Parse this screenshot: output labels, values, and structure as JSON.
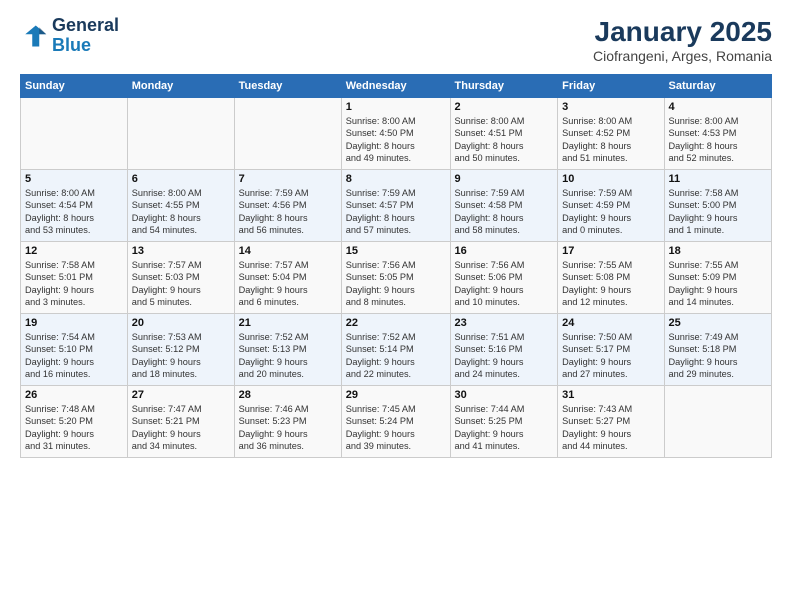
{
  "logo": {
    "line1": "General",
    "line2": "Blue"
  },
  "calendar": {
    "title": "January 2025",
    "subtitle": "Ciofrangeni, Arges, Romania"
  },
  "weekdays": [
    "Sunday",
    "Monday",
    "Tuesday",
    "Wednesday",
    "Thursday",
    "Friday",
    "Saturday"
  ],
  "weeks": [
    [
      {
        "day": "",
        "info": ""
      },
      {
        "day": "",
        "info": ""
      },
      {
        "day": "",
        "info": ""
      },
      {
        "day": "1",
        "info": "Sunrise: 8:00 AM\nSunset: 4:50 PM\nDaylight: 8 hours\nand 49 minutes."
      },
      {
        "day": "2",
        "info": "Sunrise: 8:00 AM\nSunset: 4:51 PM\nDaylight: 8 hours\nand 50 minutes."
      },
      {
        "day": "3",
        "info": "Sunrise: 8:00 AM\nSunset: 4:52 PM\nDaylight: 8 hours\nand 51 minutes."
      },
      {
        "day": "4",
        "info": "Sunrise: 8:00 AM\nSunset: 4:53 PM\nDaylight: 8 hours\nand 52 minutes."
      }
    ],
    [
      {
        "day": "5",
        "info": "Sunrise: 8:00 AM\nSunset: 4:54 PM\nDaylight: 8 hours\nand 53 minutes."
      },
      {
        "day": "6",
        "info": "Sunrise: 8:00 AM\nSunset: 4:55 PM\nDaylight: 8 hours\nand 54 minutes."
      },
      {
        "day": "7",
        "info": "Sunrise: 7:59 AM\nSunset: 4:56 PM\nDaylight: 8 hours\nand 56 minutes."
      },
      {
        "day": "8",
        "info": "Sunrise: 7:59 AM\nSunset: 4:57 PM\nDaylight: 8 hours\nand 57 minutes."
      },
      {
        "day": "9",
        "info": "Sunrise: 7:59 AM\nSunset: 4:58 PM\nDaylight: 8 hours\nand 58 minutes."
      },
      {
        "day": "10",
        "info": "Sunrise: 7:59 AM\nSunset: 4:59 PM\nDaylight: 9 hours\nand 0 minutes."
      },
      {
        "day": "11",
        "info": "Sunrise: 7:58 AM\nSunset: 5:00 PM\nDaylight: 9 hours\nand 1 minute."
      }
    ],
    [
      {
        "day": "12",
        "info": "Sunrise: 7:58 AM\nSunset: 5:01 PM\nDaylight: 9 hours\nand 3 minutes."
      },
      {
        "day": "13",
        "info": "Sunrise: 7:57 AM\nSunset: 5:03 PM\nDaylight: 9 hours\nand 5 minutes."
      },
      {
        "day": "14",
        "info": "Sunrise: 7:57 AM\nSunset: 5:04 PM\nDaylight: 9 hours\nand 6 minutes."
      },
      {
        "day": "15",
        "info": "Sunrise: 7:56 AM\nSunset: 5:05 PM\nDaylight: 9 hours\nand 8 minutes."
      },
      {
        "day": "16",
        "info": "Sunrise: 7:56 AM\nSunset: 5:06 PM\nDaylight: 9 hours\nand 10 minutes."
      },
      {
        "day": "17",
        "info": "Sunrise: 7:55 AM\nSunset: 5:08 PM\nDaylight: 9 hours\nand 12 minutes."
      },
      {
        "day": "18",
        "info": "Sunrise: 7:55 AM\nSunset: 5:09 PM\nDaylight: 9 hours\nand 14 minutes."
      }
    ],
    [
      {
        "day": "19",
        "info": "Sunrise: 7:54 AM\nSunset: 5:10 PM\nDaylight: 9 hours\nand 16 minutes."
      },
      {
        "day": "20",
        "info": "Sunrise: 7:53 AM\nSunset: 5:12 PM\nDaylight: 9 hours\nand 18 minutes."
      },
      {
        "day": "21",
        "info": "Sunrise: 7:52 AM\nSunset: 5:13 PM\nDaylight: 9 hours\nand 20 minutes."
      },
      {
        "day": "22",
        "info": "Sunrise: 7:52 AM\nSunset: 5:14 PM\nDaylight: 9 hours\nand 22 minutes."
      },
      {
        "day": "23",
        "info": "Sunrise: 7:51 AM\nSunset: 5:16 PM\nDaylight: 9 hours\nand 24 minutes."
      },
      {
        "day": "24",
        "info": "Sunrise: 7:50 AM\nSunset: 5:17 PM\nDaylight: 9 hours\nand 27 minutes."
      },
      {
        "day": "25",
        "info": "Sunrise: 7:49 AM\nSunset: 5:18 PM\nDaylight: 9 hours\nand 29 minutes."
      }
    ],
    [
      {
        "day": "26",
        "info": "Sunrise: 7:48 AM\nSunset: 5:20 PM\nDaylight: 9 hours\nand 31 minutes."
      },
      {
        "day": "27",
        "info": "Sunrise: 7:47 AM\nSunset: 5:21 PM\nDaylight: 9 hours\nand 34 minutes."
      },
      {
        "day": "28",
        "info": "Sunrise: 7:46 AM\nSunset: 5:23 PM\nDaylight: 9 hours\nand 36 minutes."
      },
      {
        "day": "29",
        "info": "Sunrise: 7:45 AM\nSunset: 5:24 PM\nDaylight: 9 hours\nand 39 minutes."
      },
      {
        "day": "30",
        "info": "Sunrise: 7:44 AM\nSunset: 5:25 PM\nDaylight: 9 hours\nand 41 minutes."
      },
      {
        "day": "31",
        "info": "Sunrise: 7:43 AM\nSunset: 5:27 PM\nDaylight: 9 hours\nand 44 minutes."
      },
      {
        "day": "",
        "info": ""
      }
    ]
  ]
}
